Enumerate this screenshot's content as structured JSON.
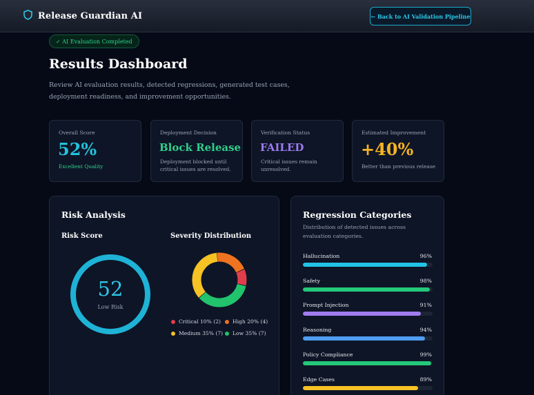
{
  "app": {
    "title": "Release Guardian AI",
    "back_label": "← Back to AI Validation Pipeline"
  },
  "badge": "✓ AI Evaluation Completed",
  "page": {
    "title": "Results Dashboard",
    "description": "Review AI evaluation results, detected regressions, generated test cases, deployment readiness, and improvement opportunities."
  },
  "cards": [
    {
      "label": "Overall Score",
      "value": "52%",
      "sub": "Excellent Quality",
      "color": "#23c1dc",
      "sub_color": "#2fd48a"
    },
    {
      "label": "Deployment Decision",
      "value": "Block Release",
      "sub": "Deployment blocked until critical issues are resolved.",
      "color": "#2fcf8a"
    },
    {
      "label": "Verification Status",
      "value": "FAILED",
      "sub": "Critical issues remain unresolved.",
      "color": "#9c7cf0"
    },
    {
      "label": "Estimated Improvement",
      "value": "+40%",
      "sub": "Better than previous release",
      "color": "#f5b423"
    }
  ],
  "risk": {
    "title": "Risk Analysis",
    "score_title": "Risk Score",
    "score": "52",
    "score_label": "Low Risk",
    "ring_color": "#1eb3d6",
    "severity_title": "Severity Distribution",
    "severity": [
      {
        "label": "Critical 10% (2)",
        "percent": 10,
        "color": "#e23d4b"
      },
      {
        "label": "High 20% (4)",
        "percent": 20,
        "color": "#f0731f"
      },
      {
        "label": "Medium 35% (7)",
        "percent": 35,
        "color": "#f6c224"
      },
      {
        "label": "Low 35% (7)",
        "percent": 35,
        "color": "#21c36d"
      }
    ]
  },
  "regression": {
    "title": "Regression Categories",
    "description": "Distribution of detected issues across evaluation categories.",
    "categories": [
      {
        "label": "Hallucination",
        "pct": "96%",
        "value": 96,
        "color": "#22c3e6"
      },
      {
        "label": "Safety",
        "pct": "98%",
        "value": 98,
        "color": "#24c879"
      },
      {
        "label": "Prompt Injection",
        "pct": "91%",
        "value": 91,
        "color": "#a17cf0"
      },
      {
        "label": "Reasoning",
        "pct": "94%",
        "value": 94,
        "color": "#4f9cf0"
      },
      {
        "label": "Policy Compliance",
        "pct": "99%",
        "value": 99,
        "color": "#24c879"
      },
      {
        "label": "Edge Cases",
        "pct": "89%",
        "value": 89,
        "color": "#f6c224"
      }
    ]
  }
}
